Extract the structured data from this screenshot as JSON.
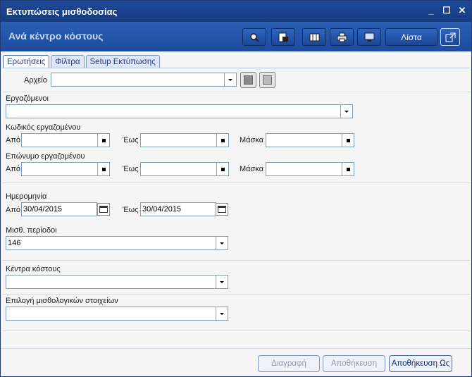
{
  "window": {
    "title": "Εκτυπώσεις μισθοδοσίας"
  },
  "window_controls": {
    "minimize": "_",
    "maximize": "☐",
    "close": "✕"
  },
  "header": {
    "subtitle": "Ανά κέντρο κόστους",
    "list_label": "Λίστα"
  },
  "toolbar_icons": [
    "search-icon",
    "preview-icon",
    "columns-icon",
    "print-icon",
    "monitor-icon",
    "list-button",
    "export-icon"
  ],
  "tabs": [
    {
      "label": "Ερωτήσεις"
    },
    {
      "label": "Φίλτρα"
    },
    {
      "label": "Setup Εκτύπωσης"
    }
  ],
  "archive": {
    "label": "Αρχείο",
    "value": ""
  },
  "employees": {
    "label": "Εργαζόμενοι",
    "value": ""
  },
  "employee_code": {
    "label": "Κωδικός εργαζομένου",
    "from_label": "Από",
    "to_label": "Έως",
    "mask_label": "Μάσκα",
    "from": "",
    "to": "",
    "mask": ""
  },
  "employee_surname": {
    "label": "Επώνυμο εργαζομένου",
    "from_label": "Από",
    "to_label": "Έως",
    "mask_label": "Μάσκα",
    "from": "",
    "to": "",
    "mask": ""
  },
  "date": {
    "label": "Ημερομηνία",
    "from_label": "Από",
    "to_label": "Έως",
    "from": "30/04/2015",
    "to": "30/04/2015"
  },
  "payroll_period": {
    "label": "Μισθ. περίοδοι",
    "value": "146"
  },
  "cost_centers": {
    "label": "Κέντρα κόστους",
    "value": ""
  },
  "payroll_items": {
    "label": "Επιλογή μισθολογικών στοιχείων",
    "value": ""
  },
  "footer": {
    "delete": "Διαγραφή",
    "save": "Αποθήκευση",
    "save_as": "Αποθήκευση Ως"
  }
}
